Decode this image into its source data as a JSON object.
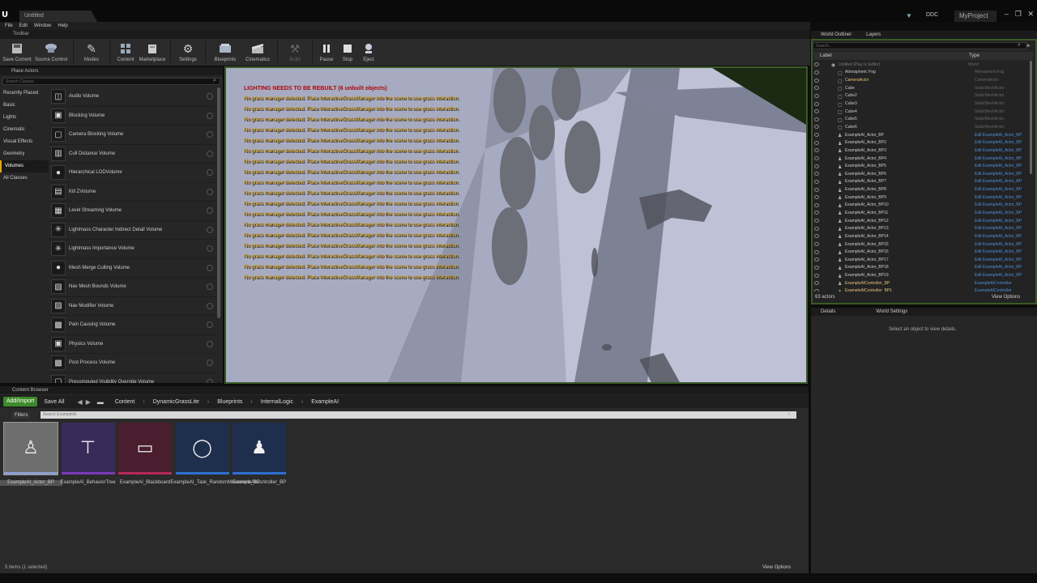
{
  "window": {
    "tab_title": "Untitled",
    "ddc": "DDC",
    "project": "MyProject",
    "controls": [
      "–",
      "❐",
      "✕"
    ]
  },
  "menu": [
    "File",
    "Edit",
    "Window",
    "Help"
  ],
  "toolbar": {
    "tab_label": "Toolbar",
    "buttons": [
      {
        "label": "Save Current",
        "icon": "save-icon"
      },
      {
        "label": "Source Control",
        "icon": "source-control-icon"
      },
      {
        "label": "Modes",
        "icon": "modes-icon"
      },
      {
        "label": "Content",
        "icon": "content-icon"
      },
      {
        "label": "Marketplace",
        "icon": "marketplace-icon"
      },
      {
        "label": "Settings",
        "icon": "settings-icon"
      },
      {
        "label": "Blueprints",
        "icon": "blueprints-icon"
      },
      {
        "label": "Cinematics",
        "icon": "cinematics-icon"
      },
      {
        "label": "Build",
        "icon": "build-icon"
      },
      {
        "label": "Pause",
        "icon": "pause-icon"
      },
      {
        "label": "Stop",
        "icon": "stop-icon"
      },
      {
        "label": "Eject",
        "icon": "eject-icon"
      }
    ]
  },
  "place_actors": {
    "tab_label": "Place Actors",
    "search_placeholder": "Search Classes",
    "categories": [
      "Recently Placed",
      "Basic",
      "Lights",
      "Cinematic",
      "Visual Effects",
      "Geometry",
      "Volumes",
      "All Classes"
    ],
    "selected_category": "Volumes",
    "volumes": [
      "Audio Volume",
      "Blocking Volume",
      "Camera Blocking Volume",
      "Cull Distance Volume",
      "Hierarchical LODVolume",
      "Kill ZVolume",
      "Level Streaming Volume",
      "Lightmass Character Indirect Detail Volume",
      "Lightmass Importance Volume",
      "Mesh Merge Culling Volume",
      "Nav Mesh Bounds Volume",
      "Nav Modifier Volume",
      "Pain Causing Volume",
      "Physics Volume",
      "Post Process Volume",
      "Precomputed Visibility Override Volume"
    ]
  },
  "viewport": {
    "warning_title": "LIGHTING NEEDS TO BE REBUILT (6 unbuilt objects)",
    "warning_line": "No grass manager detected. Place InteractiveGrassManager into the scene to use grass interaction.",
    "warning_count": 18
  },
  "outliner": {
    "tabs": [
      "World Outliner",
      "Layers"
    ],
    "search_placeholder": "Search...",
    "col_label": "Label",
    "col_type": "Type",
    "rows": [
      {
        "name": "Untitled (Play In Editor)",
        "type": "World",
        "link": false,
        "dim": true
      },
      {
        "name": "Atmospheric Fog",
        "type": "AtmosphericFog",
        "link": false
      },
      {
        "name": "CameraActor",
        "type": "CameraActor",
        "link": false,
        "highlight": true
      },
      {
        "name": "Cube",
        "type": "StaticMeshActor",
        "link": false
      },
      {
        "name": "Cube2",
        "type": "StaticMeshActor",
        "link": false
      },
      {
        "name": "Cube3",
        "type": "StaticMeshActor",
        "link": false
      },
      {
        "name": "Cube4",
        "type": "StaticMeshActor",
        "link": false
      },
      {
        "name": "Cube5",
        "type": "StaticMeshActor",
        "link": false
      },
      {
        "name": "Cube6",
        "type": "StaticMeshActor",
        "link": false
      },
      {
        "name": "ExampleAI_Actor_BP",
        "type": "Edit ExampleAI_Actor_BP",
        "link": true
      },
      {
        "name": "ExampleAI_Actor_BP2",
        "type": "Edit ExampleAI_Actor_BP",
        "link": true
      },
      {
        "name": "ExampleAI_Actor_BP3",
        "type": "Edit ExampleAI_Actor_BP",
        "link": true
      },
      {
        "name": "ExampleAI_Actor_BP4",
        "type": "Edit ExampleAI_Actor_BP",
        "link": true
      },
      {
        "name": "ExampleAI_Actor_BP5",
        "type": "Edit ExampleAI_Actor_BP",
        "link": true
      },
      {
        "name": "ExampleAI_Actor_BP6",
        "type": "Edit ExampleAI_Actor_BP",
        "link": true
      },
      {
        "name": "ExampleAI_Actor_BP7",
        "type": "Edit ExampleAI_Actor_BP",
        "link": true
      },
      {
        "name": "ExampleAI_Actor_BP8",
        "type": "Edit ExampleAI_Actor_BP",
        "link": true
      },
      {
        "name": "ExampleAI_Actor_BP9",
        "type": "Edit ExampleAI_Actor_BP",
        "link": true
      },
      {
        "name": "ExampleAI_Actor_BP10",
        "type": "Edit ExampleAI_Actor_BP",
        "link": true
      },
      {
        "name": "ExampleAI_Actor_BP11",
        "type": "Edit ExampleAI_Actor_BP",
        "link": true
      },
      {
        "name": "ExampleAI_Actor_BP12",
        "type": "Edit ExampleAI_Actor_BP",
        "link": true
      },
      {
        "name": "ExampleAI_Actor_BP13",
        "type": "Edit ExampleAI_Actor_BP",
        "link": true
      },
      {
        "name": "ExampleAI_Actor_BP14",
        "type": "Edit ExampleAI_Actor_BP",
        "link": true
      },
      {
        "name": "ExampleAI_Actor_BP15",
        "type": "Edit ExampleAI_Actor_BP",
        "link": true
      },
      {
        "name": "ExampleAI_Actor_BP16",
        "type": "Edit ExampleAI_Actor_BP",
        "link": true
      },
      {
        "name": "ExampleAI_Actor_BP17",
        "type": "Edit ExampleAI_Actor_BP",
        "link": true
      },
      {
        "name": "ExampleAI_Actor_BP18",
        "type": "Edit ExampleAI_Actor_BP",
        "link": true
      },
      {
        "name": "ExampleAI_Actor_BP19",
        "type": "Edit ExampleAI_Actor_BP",
        "link": true
      },
      {
        "name": "ExampleAIController_BP",
        "type": "ExampleAIController",
        "link": true,
        "highlight": true
      },
      {
        "name": "ExampleAIController_BP1",
        "type": "ExampleAIController",
        "link": true,
        "highlight": true
      }
    ],
    "actor_count": "63 actors",
    "view_options": "View Options"
  },
  "details": {
    "tabs": [
      "Details",
      "World Settings"
    ],
    "empty_text": "Select an object to view details."
  },
  "content_browser": {
    "tab_label": "Content Browser",
    "add_import": "Add/Import",
    "save_all": "Save All",
    "breadcrumbs": [
      "Content",
      "DynamicGrassLite",
      "Blueprints",
      "InternalLogic",
      "ExampleAI"
    ],
    "filters": "Filters",
    "search_placeholder": "Search ExampleAI",
    "assets": [
      {
        "label": "ExampleAI_Actor_BP",
        "icon": "mannequin-icon",
        "bg": "#6a6a6a",
        "stripe": "#8ea0d0",
        "selected": true
      },
      {
        "label": "ExampleAI_BehaviorTree",
        "icon": "behavior-tree-icon",
        "bg": "#3a2a5a",
        "stripe": "#7a3ab8"
      },
      {
        "label": "ExampleAI_Blackboard",
        "icon": "blackboard-icon",
        "bg": "#4a1e2e",
        "stripe": "#b8285a"
      },
      {
        "label": "ExampleAI_Task_RandomMovement_BP",
        "icon": "task-icon",
        "bg": "#1e2f4e",
        "stripe": "#2f6fd0"
      },
      {
        "label": "ExampleAIController_BP",
        "icon": "controller-icon",
        "bg": "#1e2f4e",
        "stripe": "#2f6fd0"
      }
    ],
    "status": "5 items (1 selected)",
    "view_options": "View Options"
  }
}
